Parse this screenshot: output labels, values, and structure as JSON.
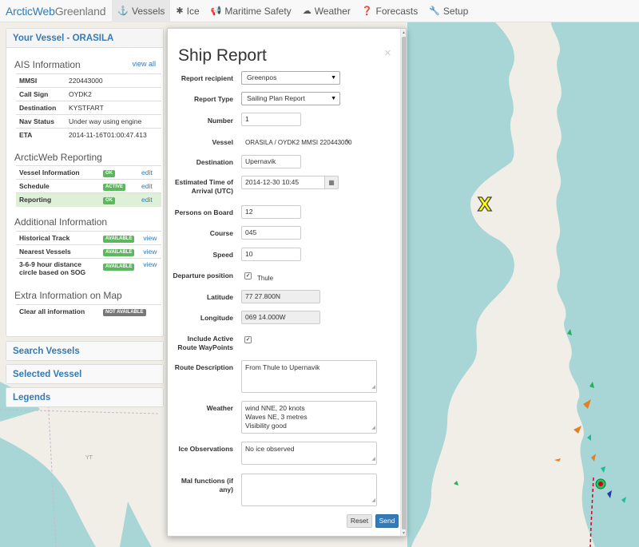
{
  "navbar": {
    "brand_part1": "ArcticWeb",
    "brand_part2": "Greenland",
    "items": [
      {
        "label": "Vessels",
        "icon": "anchor-icon",
        "active": true
      },
      {
        "label": "Ice",
        "icon": "snowflake-icon",
        "active": false
      },
      {
        "label": "Maritime Safety",
        "icon": "bullhorn-icon",
        "active": false
      },
      {
        "label": "Weather",
        "icon": "cloud-icon",
        "active": false
      },
      {
        "label": "Forecasts",
        "icon": "question-icon",
        "active": false
      },
      {
        "label": "Setup",
        "icon": "wrench-icon",
        "active": false
      }
    ]
  },
  "vessel_panel": {
    "title": "Your Vessel - ORASILA",
    "ais": {
      "title": "AIS Information",
      "view_all": "view all",
      "rows": [
        {
          "key": "MMSI",
          "value": "220443000"
        },
        {
          "key": "Call Sign",
          "value": "OYDK2"
        },
        {
          "key": "Destination",
          "value": "KYSTFART"
        },
        {
          "key": "Nav Status",
          "value": "Under way using engine"
        },
        {
          "key": "ETA",
          "value": "2014-11-16T01:00:47.413"
        }
      ]
    },
    "reporting": {
      "title": "ArcticWeb Reporting",
      "rows": [
        {
          "key": "Vessel Information",
          "badge": "OK",
          "link": "edit"
        },
        {
          "key": "Schedule",
          "badge": "ACTIVE",
          "link": "edit"
        },
        {
          "key": "Reporting",
          "badge": "OK",
          "link": "edit"
        }
      ]
    },
    "additional": {
      "title": "Additional Information",
      "rows": [
        {
          "key": "Historical Track",
          "badge": "AVAILABLE",
          "link": "view"
        },
        {
          "key": "Nearest Vessels",
          "badge": "AVAILABLE",
          "link": "view"
        },
        {
          "key": "3-6-9 hour distance circle based on SOG",
          "badge": "AVAILABLE",
          "link": "view"
        }
      ]
    },
    "extra": {
      "title": "Extra Information on Map",
      "rows": [
        {
          "key": "Clear all information",
          "badge": "NOT AVAILABLE"
        }
      ]
    }
  },
  "collapsed_panels": [
    "Search Vessels",
    "Selected Vessel",
    "Legends"
  ],
  "ship_report": {
    "title": "Ship Report",
    "close": "×",
    "fields": {
      "recipient": {
        "label": "Report recipient",
        "value": "Greenpos"
      },
      "type": {
        "label": "Report Type",
        "value": "Sailing Plan Report"
      },
      "number": {
        "label": "Number",
        "value": "1"
      },
      "vessel": {
        "label": "Vessel",
        "value": "ORASILA / OYDK2 MMSI 220443000"
      },
      "destination": {
        "label": "Destination",
        "value": "Upernavik"
      },
      "eta": {
        "label": "Estimated Time of Arrival (UTC)",
        "value": "2014-12-30 10:45"
      },
      "persons": {
        "label": "Persons on Board",
        "value": "12"
      },
      "course": {
        "label": "Course",
        "value": "045"
      },
      "speed": {
        "label": "Speed",
        "value": "10"
      },
      "departure": {
        "label": "Departure position",
        "value": "Thule",
        "checked": true
      },
      "latitude": {
        "label": "Latitude",
        "value": "77 27.800N"
      },
      "longitude": {
        "label": "Longitude",
        "value": "069 14.000W"
      },
      "waypoints": {
        "label": "Include Active Route WayPoints",
        "checked": true
      },
      "route_desc": {
        "label": "Route Description",
        "value": "From Thule to Upernavik"
      },
      "weather": {
        "label": "Weather",
        "value": "wind NNE, 20 knots\nWaves NE, 3 metres\nVisibility good"
      },
      "ice": {
        "label": "Ice Observations",
        "value": "No ice observed"
      },
      "malfunctions": {
        "label": "Mal functions (if any)",
        "value": ""
      }
    },
    "buttons": {
      "reset": "Reset",
      "send": "Send"
    }
  },
  "map": {
    "marker": "X",
    "region_label": "YT",
    "colors": {
      "water": "#a8d6d6",
      "land": "#f1eee8",
      "route": "#d9001b"
    }
  }
}
